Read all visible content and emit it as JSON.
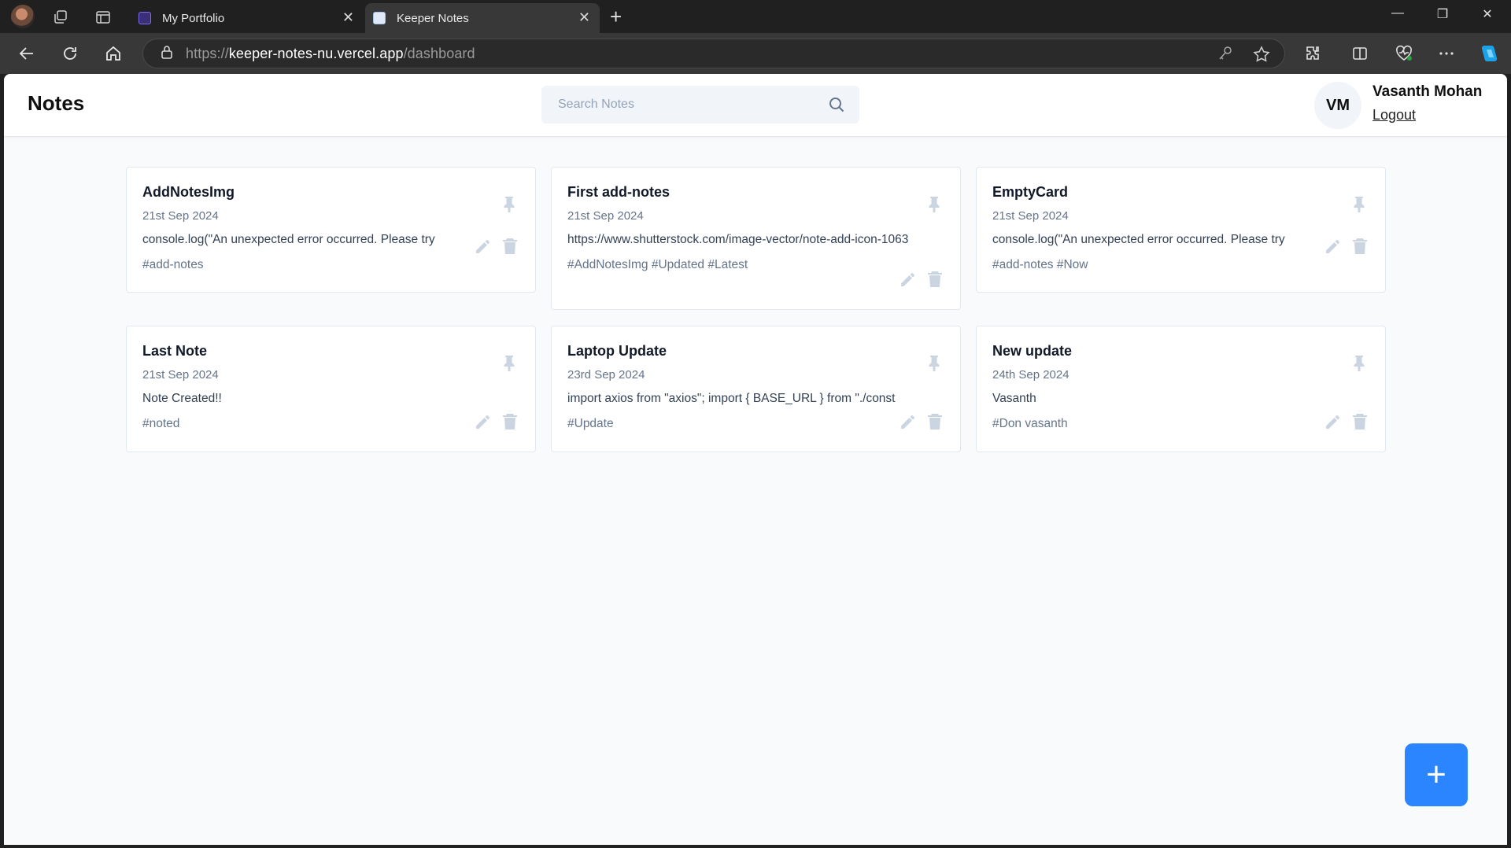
{
  "browser": {
    "tabs": [
      {
        "title": "My Portfolio",
        "active": false
      },
      {
        "title": "Keeper Notes",
        "active": true
      }
    ],
    "url": {
      "scheme": "https://",
      "host": "keeper-notes-nu.vercel.app",
      "path": "/dashboard"
    }
  },
  "header": {
    "title": "Notes",
    "search_placeholder": "Search Notes",
    "user": {
      "initials": "VM",
      "name": "Vasanth Mohan",
      "logout_label": "Logout"
    }
  },
  "notes": [
    {
      "title": "AddNotesImg",
      "date": "21st Sep 2024",
      "content": "console.log(\"An unexpected error occurred. Please try",
      "tags": "#add-notes"
    },
    {
      "title": "First add-notes",
      "date": "21st Sep 2024",
      "content": "https://www.shutterstock.com/image-vector/note-add-icon-1063",
      "tags": "#AddNotesImg #Updated #Latest"
    },
    {
      "title": "EmptyCard",
      "date": "21st Sep 2024",
      "content": "console.log(\"An unexpected error occurred. Please try",
      "tags": "#add-notes #Now"
    },
    {
      "title": "Last Note",
      "date": "21st Sep 2024",
      "content": "Note Created!!",
      "tags": "#noted"
    },
    {
      "title": "Laptop Update",
      "date": "23rd Sep 2024",
      "content": "import axios from \"axios\"; import { BASE_URL } from \"./const",
      "tags": "#Update"
    },
    {
      "title": "New update",
      "date": "24th Sep 2024",
      "content": "Vasanth",
      "tags": "#Don vasanth"
    }
  ],
  "fab_label": "+",
  "colors": {
    "accent": "#2b85ff",
    "background": "#f8fafc",
    "icon_muted": "#cbd5e1"
  }
}
